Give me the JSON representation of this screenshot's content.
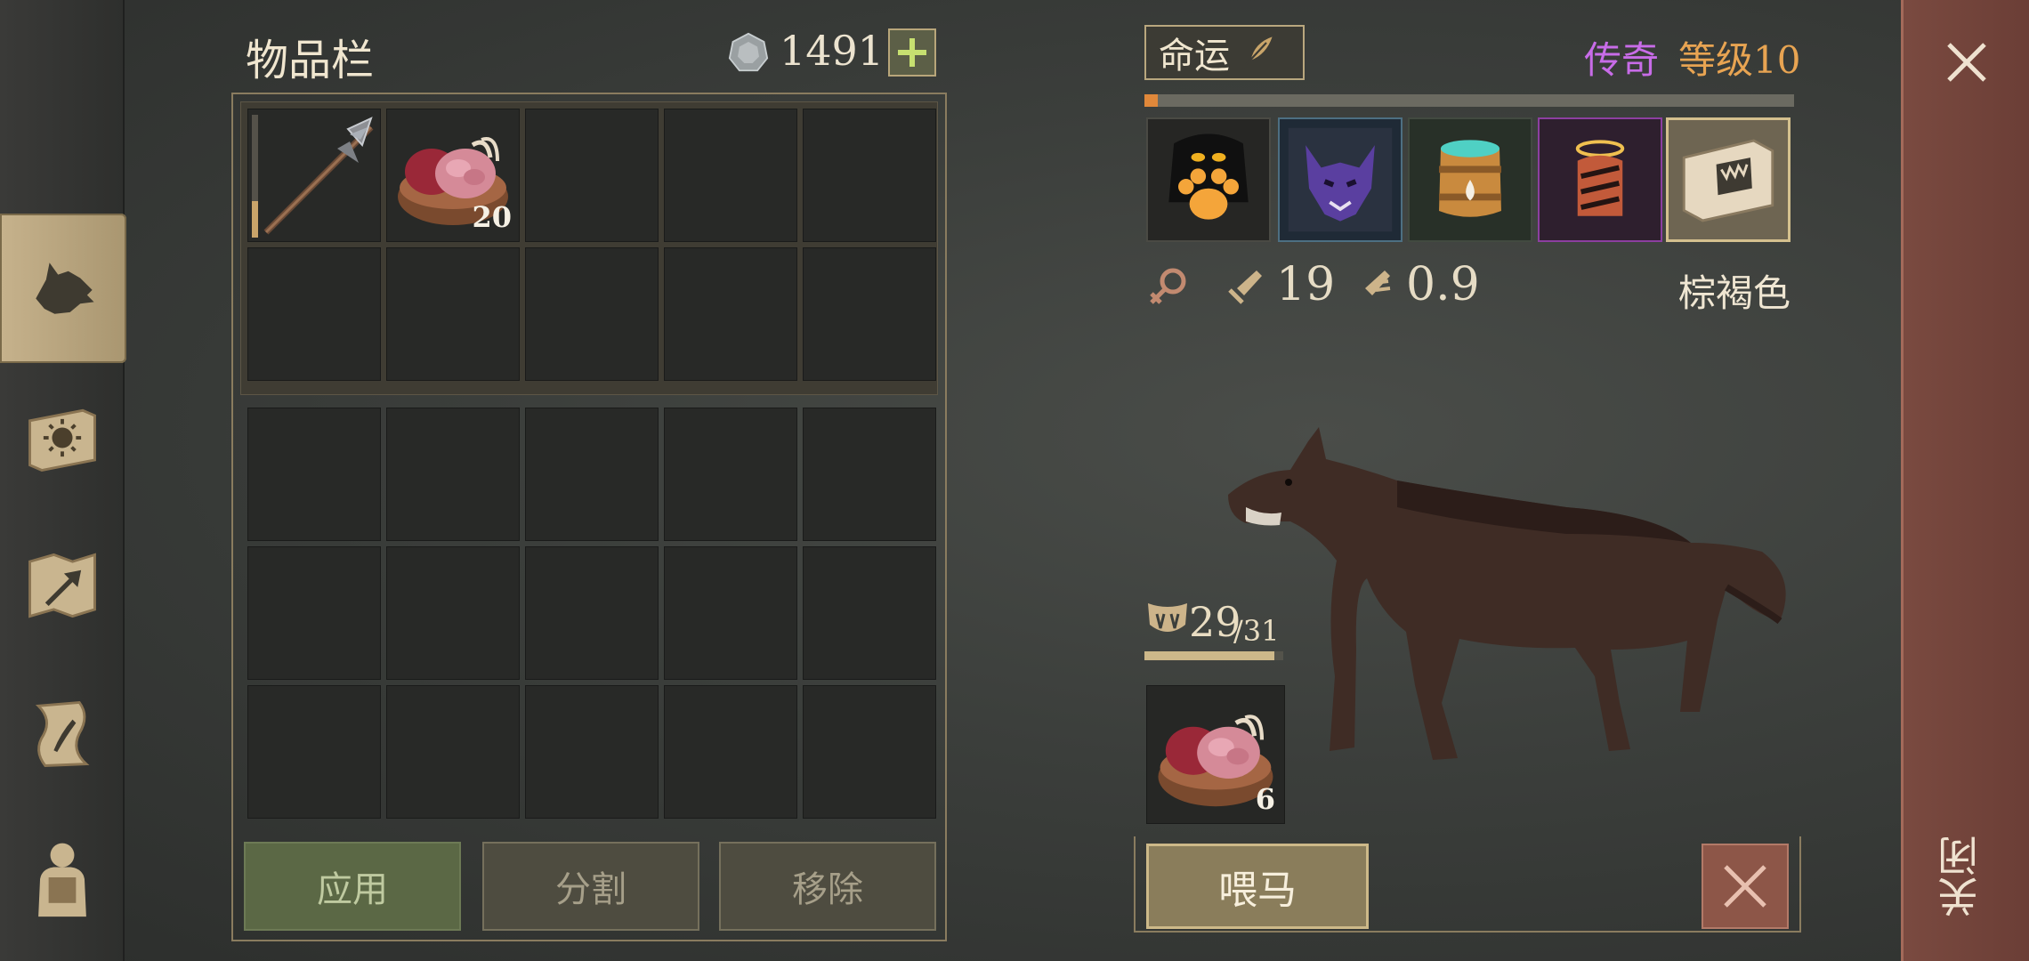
{
  "inventory": {
    "title": "物品栏",
    "currency_value": "1491",
    "slots": [
      {
        "item": "halberd",
        "durability": 0.3
      },
      {
        "item": "raw-meat-bowl",
        "count": "20"
      }
    ],
    "buttons": {
      "apply": "应用",
      "split": "分割",
      "remove": "移除"
    }
  },
  "pet": {
    "fate_label": "命运",
    "rarity": "传奇",
    "level": "等级10",
    "xp_fraction": 0.02,
    "traits": [
      "paw-trait-icon",
      "wolf-trait-icon",
      "barrel-trait-icon",
      "claw-trait-icon",
      "fang-book-icon"
    ],
    "attack": "19",
    "speed": "0.9",
    "color_name": "棕褐色",
    "food_current": "29",
    "food_max": "/31",
    "food_fraction": 0.935,
    "feed_item_count": "6",
    "feed_button": "喂马"
  },
  "close_label": "关闭",
  "colors": {
    "rarity": "#c86ce8",
    "level": "#e8a452",
    "accent": "#cdb989"
  }
}
